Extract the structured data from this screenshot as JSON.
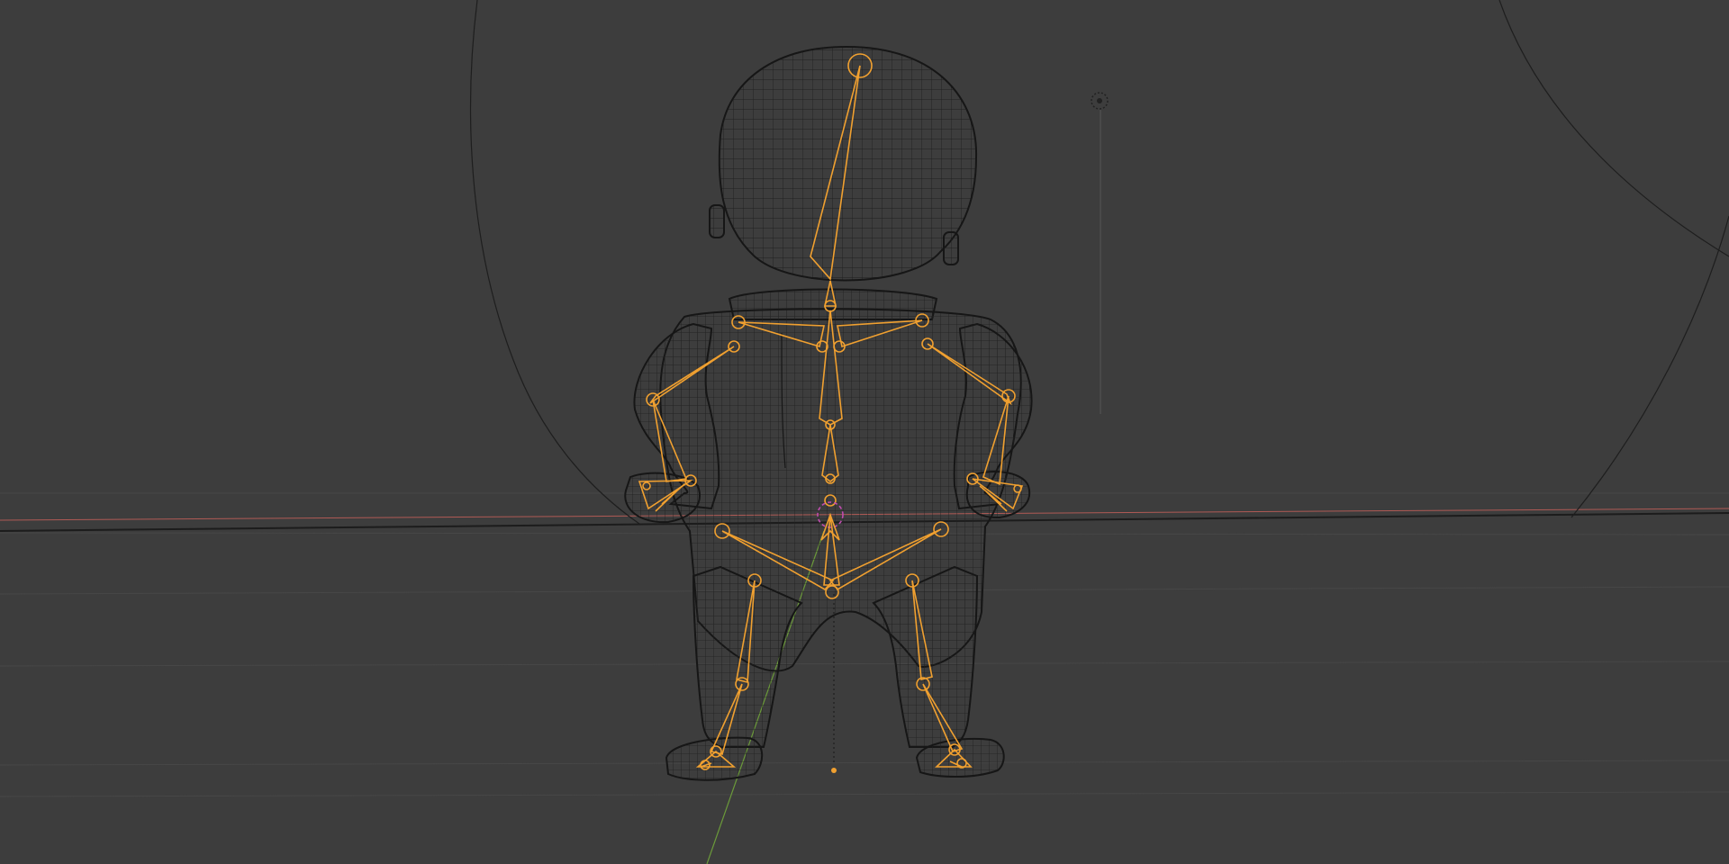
{
  "viewport": {
    "mode": "wireframe",
    "background_color": "#3d3d3d",
    "grid_color": "#4a4a4a",
    "x_axis_color": "#c0504d",
    "y_axis_color": "#6b9a3a",
    "horizon_color": "#1c1c1c",
    "mesh_color": "#222222",
    "armature_color": "#f0a030"
  },
  "scene": {
    "objects": [
      {
        "name": "character-mesh",
        "kind": "mesh",
        "icon": "mesh-icon"
      },
      {
        "name": "character-armature",
        "kind": "armature",
        "icon": "bone-icon"
      },
      {
        "name": "scene-light",
        "kind": "light",
        "icon": "light-icon"
      },
      {
        "name": "world-origin",
        "kind": "origin",
        "icon": "origin-dot-icon"
      }
    ]
  }
}
